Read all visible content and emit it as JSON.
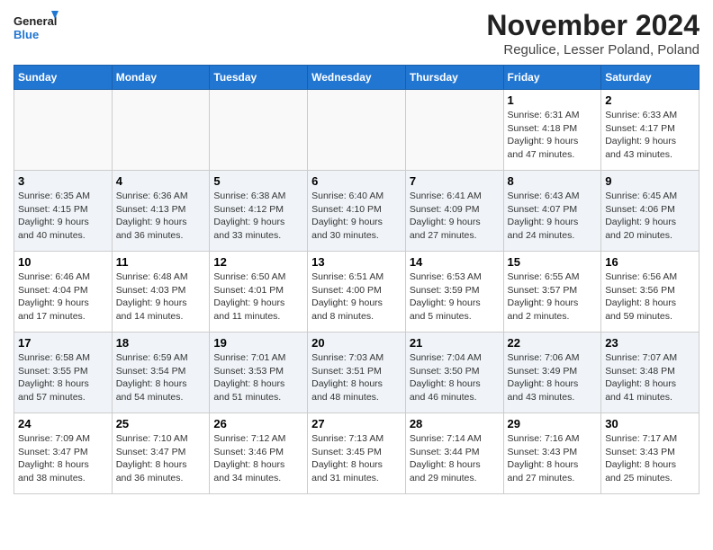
{
  "logo": {
    "line1": "General",
    "line2": "Blue"
  },
  "title": "November 2024",
  "subtitle": "Regulice, Lesser Poland, Poland",
  "headers": [
    "Sunday",
    "Monday",
    "Tuesday",
    "Wednesday",
    "Thursday",
    "Friday",
    "Saturday"
  ],
  "weeks": [
    [
      {
        "day": "",
        "info": ""
      },
      {
        "day": "",
        "info": ""
      },
      {
        "day": "",
        "info": ""
      },
      {
        "day": "",
        "info": ""
      },
      {
        "day": "",
        "info": ""
      },
      {
        "day": "1",
        "info": "Sunrise: 6:31 AM\nSunset: 4:18 PM\nDaylight: 9 hours\nand 47 minutes."
      },
      {
        "day": "2",
        "info": "Sunrise: 6:33 AM\nSunset: 4:17 PM\nDaylight: 9 hours\nand 43 minutes."
      }
    ],
    [
      {
        "day": "3",
        "info": "Sunrise: 6:35 AM\nSunset: 4:15 PM\nDaylight: 9 hours\nand 40 minutes."
      },
      {
        "day": "4",
        "info": "Sunrise: 6:36 AM\nSunset: 4:13 PM\nDaylight: 9 hours\nand 36 minutes."
      },
      {
        "day": "5",
        "info": "Sunrise: 6:38 AM\nSunset: 4:12 PM\nDaylight: 9 hours\nand 33 minutes."
      },
      {
        "day": "6",
        "info": "Sunrise: 6:40 AM\nSunset: 4:10 PM\nDaylight: 9 hours\nand 30 minutes."
      },
      {
        "day": "7",
        "info": "Sunrise: 6:41 AM\nSunset: 4:09 PM\nDaylight: 9 hours\nand 27 minutes."
      },
      {
        "day": "8",
        "info": "Sunrise: 6:43 AM\nSunset: 4:07 PM\nDaylight: 9 hours\nand 24 minutes."
      },
      {
        "day": "9",
        "info": "Sunrise: 6:45 AM\nSunset: 4:06 PM\nDaylight: 9 hours\nand 20 minutes."
      }
    ],
    [
      {
        "day": "10",
        "info": "Sunrise: 6:46 AM\nSunset: 4:04 PM\nDaylight: 9 hours\nand 17 minutes."
      },
      {
        "day": "11",
        "info": "Sunrise: 6:48 AM\nSunset: 4:03 PM\nDaylight: 9 hours\nand 14 minutes."
      },
      {
        "day": "12",
        "info": "Sunrise: 6:50 AM\nSunset: 4:01 PM\nDaylight: 9 hours\nand 11 minutes."
      },
      {
        "day": "13",
        "info": "Sunrise: 6:51 AM\nSunset: 4:00 PM\nDaylight: 9 hours\nand 8 minutes."
      },
      {
        "day": "14",
        "info": "Sunrise: 6:53 AM\nSunset: 3:59 PM\nDaylight: 9 hours\nand 5 minutes."
      },
      {
        "day": "15",
        "info": "Sunrise: 6:55 AM\nSunset: 3:57 PM\nDaylight: 9 hours\nand 2 minutes."
      },
      {
        "day": "16",
        "info": "Sunrise: 6:56 AM\nSunset: 3:56 PM\nDaylight: 8 hours\nand 59 minutes."
      }
    ],
    [
      {
        "day": "17",
        "info": "Sunrise: 6:58 AM\nSunset: 3:55 PM\nDaylight: 8 hours\nand 57 minutes."
      },
      {
        "day": "18",
        "info": "Sunrise: 6:59 AM\nSunset: 3:54 PM\nDaylight: 8 hours\nand 54 minutes."
      },
      {
        "day": "19",
        "info": "Sunrise: 7:01 AM\nSunset: 3:53 PM\nDaylight: 8 hours\nand 51 minutes."
      },
      {
        "day": "20",
        "info": "Sunrise: 7:03 AM\nSunset: 3:51 PM\nDaylight: 8 hours\nand 48 minutes."
      },
      {
        "day": "21",
        "info": "Sunrise: 7:04 AM\nSunset: 3:50 PM\nDaylight: 8 hours\nand 46 minutes."
      },
      {
        "day": "22",
        "info": "Sunrise: 7:06 AM\nSunset: 3:49 PM\nDaylight: 8 hours\nand 43 minutes."
      },
      {
        "day": "23",
        "info": "Sunrise: 7:07 AM\nSunset: 3:48 PM\nDaylight: 8 hours\nand 41 minutes."
      }
    ],
    [
      {
        "day": "24",
        "info": "Sunrise: 7:09 AM\nSunset: 3:47 PM\nDaylight: 8 hours\nand 38 minutes."
      },
      {
        "day": "25",
        "info": "Sunrise: 7:10 AM\nSunset: 3:47 PM\nDaylight: 8 hours\nand 36 minutes."
      },
      {
        "day": "26",
        "info": "Sunrise: 7:12 AM\nSunset: 3:46 PM\nDaylight: 8 hours\nand 34 minutes."
      },
      {
        "day": "27",
        "info": "Sunrise: 7:13 AM\nSunset: 3:45 PM\nDaylight: 8 hours\nand 31 minutes."
      },
      {
        "day": "28",
        "info": "Sunrise: 7:14 AM\nSunset: 3:44 PM\nDaylight: 8 hours\nand 29 minutes."
      },
      {
        "day": "29",
        "info": "Sunrise: 7:16 AM\nSunset: 3:43 PM\nDaylight: 8 hours\nand 27 minutes."
      },
      {
        "day": "30",
        "info": "Sunrise: 7:17 AM\nSunset: 3:43 PM\nDaylight: 8 hours\nand 25 minutes."
      }
    ]
  ]
}
